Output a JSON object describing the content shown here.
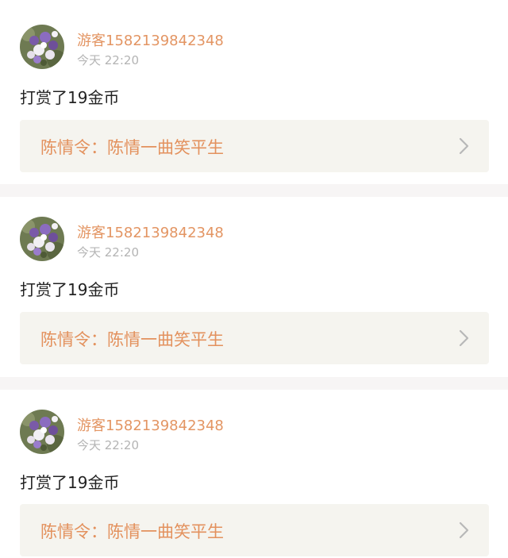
{
  "feed": {
    "items": [
      {
        "user": {
          "name": "游客1582139842348",
          "avatar_icon": "flower-avatar"
        },
        "time": "今天 22:20",
        "action": "打赏了19金币",
        "book": {
          "title": "陈情令：陈情一曲笑平生",
          "chevron_icon": "chevron-right-icon"
        }
      },
      {
        "user": {
          "name": "游客1582139842348",
          "avatar_icon": "flower-avatar"
        },
        "time": "今天 22:20",
        "action": "打赏了19金币",
        "book": {
          "title": "陈情令：陈情一曲笑平生",
          "chevron_icon": "chevron-right-icon"
        }
      },
      {
        "user": {
          "name": "游客1582139842348",
          "avatar_icon": "flower-avatar"
        },
        "time": "今天 22:20",
        "action": "打赏了19金币",
        "book": {
          "title": "陈情令：陈情一曲笑平生",
          "chevron_icon": "chevron-right-icon"
        }
      }
    ]
  },
  "colors": {
    "page_background": "#f7f5f5",
    "card_background": "#ffffff",
    "username": "#e39563",
    "timestamp": "#b4b4b4",
    "body_text": "#222222",
    "book_link_background": "#f5f4ef",
    "book_title": "#e3915d",
    "chevron": "#b8b8b8"
  }
}
